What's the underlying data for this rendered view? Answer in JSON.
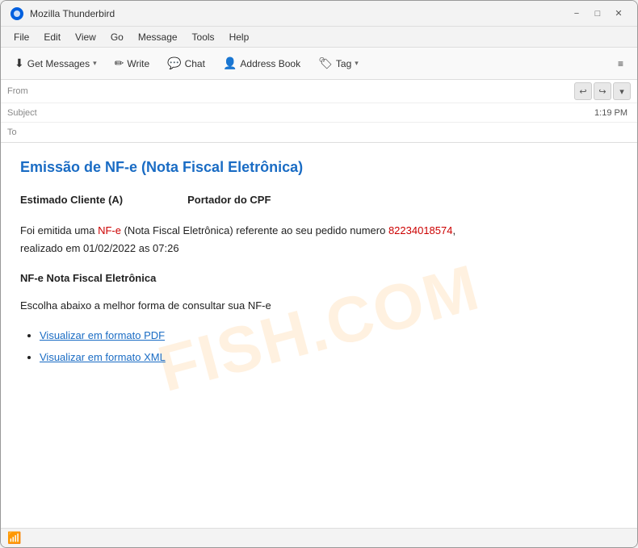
{
  "window": {
    "title": "Mozilla Thunderbird",
    "icon_color": "#0060df"
  },
  "title_bar": {
    "title": "Mozilla Thunderbird",
    "minimize_label": "−",
    "maximize_label": "□",
    "close_label": "✕"
  },
  "menu_bar": {
    "items": [
      {
        "id": "file",
        "label": "File"
      },
      {
        "id": "edit",
        "label": "Edit"
      },
      {
        "id": "view",
        "label": "View"
      },
      {
        "id": "go",
        "label": "Go"
      },
      {
        "id": "message",
        "label": "Message"
      },
      {
        "id": "tools",
        "label": "Tools"
      },
      {
        "id": "help",
        "label": "Help"
      }
    ]
  },
  "toolbar": {
    "get_messages_label": "Get Messages",
    "write_label": "Write",
    "chat_label": "Chat",
    "address_book_label": "Address Book",
    "tag_label": "Tag",
    "menu_icon": "≡"
  },
  "header": {
    "from_label": "From",
    "subject_label": "Subject",
    "to_label": "To",
    "time": "1:19 PM",
    "reply_icon": "↩",
    "forward_icon": "↪",
    "more_icon": "▾"
  },
  "email": {
    "subject": "Emissão de NF-e (Nota Fiscal Eletrônica)",
    "greeting_left": "Estimado Cliente (A)",
    "greeting_right": "Portador do CPF",
    "body_text_1": "Foi emitida uma ",
    "nf_e_label": "NF-e",
    "body_text_2": " (Nota Fiscal Eletrônica) referente ao seu pedido numero ",
    "order_number": "82234018574",
    "body_text_3": ",",
    "body_line2": "realizado em 01/02/2022 as 07:26",
    "section_title": "NF-e Nota Fiscal Eletrônica",
    "instruction": "Escolha abaixo a melhor forma de consultar sua NF-e",
    "links": [
      {
        "id": "pdf-link",
        "label": "Visualizar em formato PDF"
      },
      {
        "id": "xml-link",
        "label": "Visualizar em formato XML"
      }
    ]
  },
  "watermark": {
    "text": "FISH.COM"
  },
  "status_bar": {
    "wifi_icon": "📶"
  }
}
